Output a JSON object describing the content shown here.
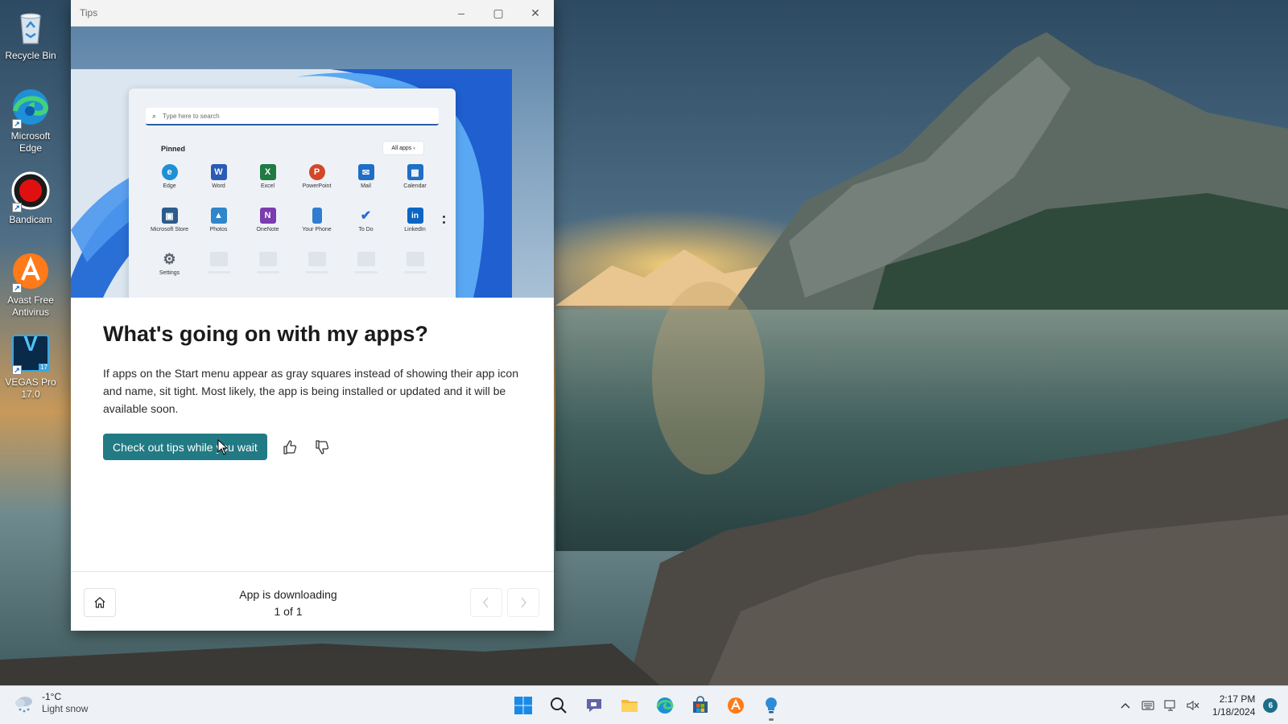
{
  "desktop": {
    "icons": [
      {
        "label": "Recycle Bin",
        "icon": "recycle-bin-icon"
      },
      {
        "label": "Microsoft Edge",
        "icon": "edge-icon"
      },
      {
        "label": "Bandicam",
        "icon": "bandicam-icon"
      },
      {
        "label": "Avast Free Antivirus",
        "icon": "avast-icon"
      },
      {
        "label": "VEGAS Pro 17.0",
        "icon": "vegas-icon"
      }
    ],
    "vegas_badge": "17",
    "vegas_letter": "V"
  },
  "window": {
    "title": "Tips",
    "controls": {
      "minimize": "–",
      "maximize": "▢",
      "close": "✕"
    }
  },
  "hero": {
    "search_placeholder": "Type here to search",
    "pinned_label": "Pinned",
    "all_apps_label": "All apps  ›",
    "apps": [
      {
        "label": "Edge",
        "color": "#1f8fd6",
        "glyph": "e"
      },
      {
        "label": "Word",
        "color": "#2b5cb5",
        "glyph": "W"
      },
      {
        "label": "Excel",
        "color": "#1f7a44",
        "glyph": "X"
      },
      {
        "label": "PowerPoint",
        "color": "#d2472a",
        "glyph": "P"
      },
      {
        "label": "Mail",
        "color": "#1f6fc7",
        "glyph": "✉"
      },
      {
        "label": "Calendar",
        "color": "#1f6fc7",
        "glyph": "▦"
      },
      {
        "label": "Microsoft Store",
        "color": "#2b5c8a",
        "glyph": "▣"
      },
      {
        "label": "Photos",
        "color": "#2f86c9",
        "glyph": "▲"
      },
      {
        "label": "OneNote",
        "color": "#7a3cae",
        "glyph": "N"
      },
      {
        "label": "Your Phone",
        "color": "#2f7dd1",
        "glyph": "▮"
      },
      {
        "label": "To Do",
        "color": "#2a68d8",
        "glyph": "✔"
      },
      {
        "label": "LinkedIn",
        "color": "#0a66c2",
        "glyph": "in"
      },
      {
        "label": "Settings",
        "color": "#6b6f78",
        "glyph": "⚙"
      }
    ]
  },
  "tip": {
    "heading": "What's going on with my apps?",
    "body": "If apps on the Start menu appear as gray squares instead of showing their app icon and name, sit tight. Most likely, the app is being installed or updated and it will be available soon.",
    "cta_label": "Check out tips while you wait",
    "like_icon": "thumbs-up-icon",
    "dislike_icon": "thumbs-down-icon"
  },
  "footer": {
    "status": "App is downloading",
    "counter": "1 of 1"
  },
  "taskbar": {
    "weather_temp": "-1°C",
    "weather_condition": "Light snow",
    "apps": [
      "start-icon",
      "search-icon",
      "teams-chat-icon",
      "file-explorer-icon",
      "edge-icon",
      "microsoft-store-icon",
      "avast-icon",
      "tips-icon"
    ],
    "tray_chevron": "^",
    "time": "2:17 PM",
    "date": "1/18/2024",
    "notifications": "6"
  },
  "colors": {
    "accent": "#217a84",
    "taskbar_bg": "#eef1f5",
    "notification_badge": "#1c6d88"
  }
}
